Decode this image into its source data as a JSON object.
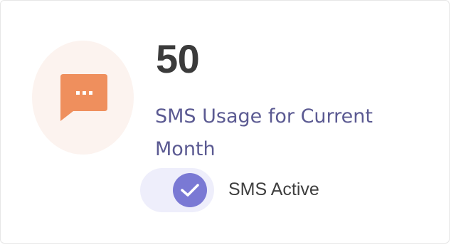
{
  "stat": {
    "value": "50",
    "label": "SMS Usage for Current Month",
    "icon": "chat-bubble-icon",
    "icon_color": "#ef8f5d",
    "icon_bg_color": "#fcf3ef"
  },
  "toggle": {
    "label": "SMS Active",
    "checked": true,
    "accent_color": "#7a79d4",
    "track_color": "#eeeefb"
  },
  "colors": {
    "value_text": "#3b3b3b",
    "label_text": "#5b5a92"
  }
}
